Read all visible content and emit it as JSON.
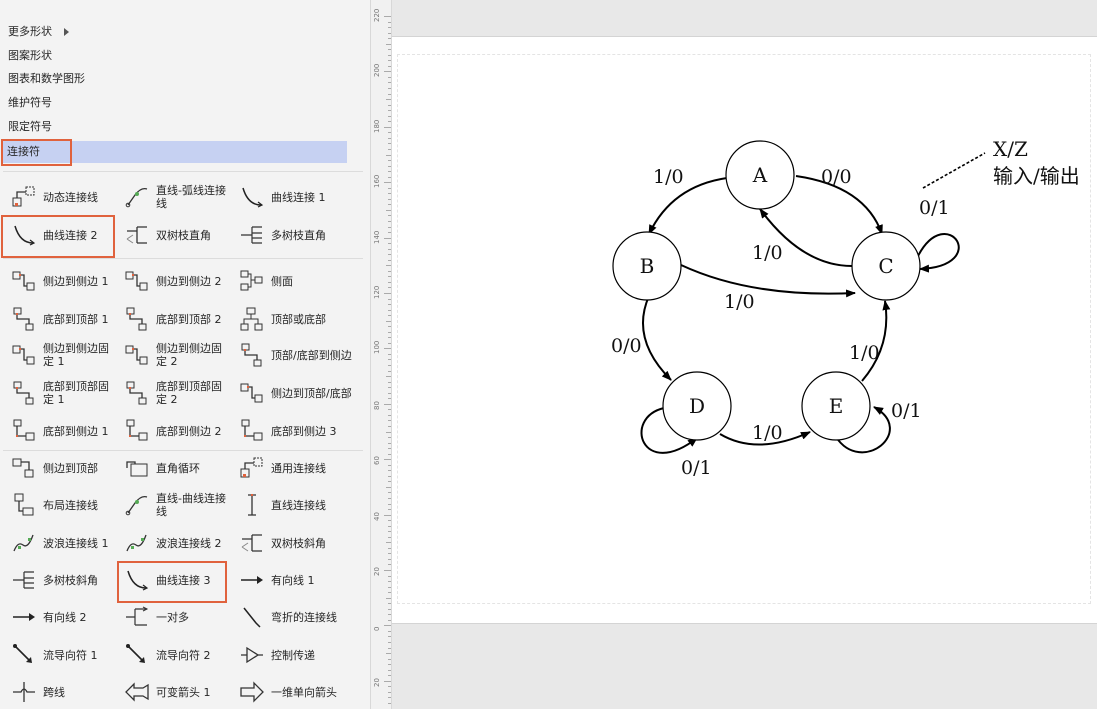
{
  "shape_menu": {
    "more_shapes": "更多形状",
    "pattern_shapes": "图案形状",
    "charts_math": "图表和数学图形",
    "maintenance_symbols": "维护符号",
    "qualifier_symbols": "限定符号",
    "connectors": "连接符"
  },
  "connector_shapes": [
    {
      "name": "dynamic-connector",
      "label": "动态连接线",
      "icon": "dynamic-connector-icon"
    },
    {
      "name": "line-arc-connector",
      "label": "直线-弧线连接线",
      "icon": "line-arc-icon"
    },
    {
      "name": "curve-connector-1",
      "label": "曲线连接 1",
      "icon": "curve-icon"
    },
    {
      "name": "curve-connector-2",
      "label": "曲线连接 2",
      "icon": "curve-icon"
    },
    {
      "name": "double-tree-right-angle",
      "label": "双树枝直角",
      "icon": "double-tree-icon"
    },
    {
      "name": "multi-tree-right-angle",
      "label": "多树枝直角",
      "icon": "multi-tree-icon"
    },
    {
      "name": "side-to-side-1",
      "label": "侧边到侧边 1",
      "icon": "side-to-side-icon"
    },
    {
      "name": "side-to-side-2",
      "label": "侧边到侧边 2",
      "icon": "side-to-side-icon"
    },
    {
      "name": "side",
      "label": "侧面",
      "icon": "side-icon"
    },
    {
      "name": "bottom-to-top-1",
      "label": "底部到顶部 1",
      "icon": "bottom-to-top-icon"
    },
    {
      "name": "bottom-to-top-2",
      "label": "底部到顶部 2",
      "icon": "bottom-to-top-icon"
    },
    {
      "name": "top-or-bottom",
      "label": "顶部或底部",
      "icon": "top-or-bottom-icon"
    },
    {
      "name": "side-to-side-fixed-1",
      "label": "侧边到侧边固定 1",
      "icon": "side-to-side-icon"
    },
    {
      "name": "side-to-side-fixed-2",
      "label": "侧边到侧边固定 2",
      "icon": "side-to-side-icon"
    },
    {
      "name": "top-bottom-to-side",
      "label": "顶部/底部到侧边",
      "icon": "bottom-to-top-icon"
    },
    {
      "name": "bottom-to-top-fixed-1",
      "label": "底部到顶部固定 1",
      "icon": "bottom-to-top-icon"
    },
    {
      "name": "bottom-to-top-fixed-2",
      "label": "底部到顶部固定 2",
      "icon": "bottom-to-top-icon"
    },
    {
      "name": "side-to-top-bottom",
      "label": "侧边到顶部/底部",
      "icon": "side-to-side-icon"
    },
    {
      "name": "bottom-to-side-1",
      "label": "底部到侧边 1",
      "icon": "bottom-to-side-icon"
    },
    {
      "name": "bottom-to-side-2",
      "label": "底部到侧边 2",
      "icon": "bottom-to-side-icon"
    },
    {
      "name": "bottom-to-side-3",
      "label": "底部到侧边 3",
      "icon": "bottom-to-side-icon"
    },
    {
      "name": "side-to-top",
      "label": "侧边到顶部",
      "icon": "side-to-top-icon"
    },
    {
      "name": "right-angle-loop",
      "label": "直角循环",
      "icon": "loop-icon"
    },
    {
      "name": "generic-connector",
      "label": "通用连接线",
      "icon": "dynamic-connector-icon"
    },
    {
      "name": "layout-connector",
      "label": "布局连接线",
      "icon": "layout-icon"
    },
    {
      "name": "line-curve-connector",
      "label": "直线-曲线连接线",
      "icon": "line-arc-icon"
    },
    {
      "name": "straight-connector",
      "label": "直线连接线",
      "icon": "straight-icon"
    },
    {
      "name": "wave-connector-1",
      "label": "波浪连接线 1",
      "icon": "wave-icon"
    },
    {
      "name": "wave-connector-2",
      "label": "波浪连接线 2",
      "icon": "wave-icon"
    },
    {
      "name": "double-tree-oblique",
      "label": "双树枝斜角",
      "icon": "double-tree-icon"
    },
    {
      "name": "multi-tree-oblique",
      "label": "多树枝斜角",
      "icon": "multi-tree-icon"
    },
    {
      "name": "curve-connector-3",
      "label": "曲线连接 3",
      "icon": "curve-icon"
    },
    {
      "name": "directed-line-1",
      "label": "有向线 1",
      "icon": "arrow-line-icon"
    },
    {
      "name": "directed-line-2",
      "label": "有向线 2",
      "icon": "arrow-line-icon"
    },
    {
      "name": "one-to-many",
      "label": "一对多",
      "icon": "one-to-many-icon"
    },
    {
      "name": "bent-connector",
      "label": "弯折的连接线",
      "icon": "bent-icon"
    },
    {
      "name": "flow-director-1",
      "label": "流导向符 1",
      "icon": "flow-icon"
    },
    {
      "name": "flow-director-2",
      "label": "流导向符 2",
      "icon": "flow-icon"
    },
    {
      "name": "control-transfer",
      "label": "控制传递",
      "icon": "control-transfer-icon"
    },
    {
      "name": "jump-line",
      "label": "跨线",
      "icon": "jump-icon"
    },
    {
      "name": "variable-arrow-1",
      "label": "可变箭头 1",
      "icon": "double-arrow-icon"
    },
    {
      "name": "1d-single-arrow",
      "label": "一维单向箭头",
      "icon": "block-arrow-icon"
    }
  ],
  "ruler": {
    "labels": [
      "220",
      "200",
      "180",
      "160",
      "140",
      "120",
      "100",
      "80",
      "60",
      "40",
      "20",
      "0",
      "20"
    ]
  },
  "diagram": {
    "states": [
      {
        "id": "A",
        "label": "A"
      },
      {
        "id": "B",
        "label": "B"
      },
      {
        "id": "C",
        "label": "C"
      },
      {
        "id": "D",
        "label": "D"
      },
      {
        "id": "E",
        "label": "E"
      }
    ],
    "transition_labels": {
      "a_to_b": "1/0",
      "a_to_c": "0/0",
      "c_to_a": "1/0",
      "b_to_c": "1/0",
      "c_self": "0/1",
      "b_to_d": "0/0",
      "d_self": "0/1",
      "d_to_e": "1/0",
      "e_self": "0/1",
      "e_to_c": "1/0"
    },
    "legend": {
      "key": "X/Z",
      "meaning": "输入/输出"
    }
  }
}
